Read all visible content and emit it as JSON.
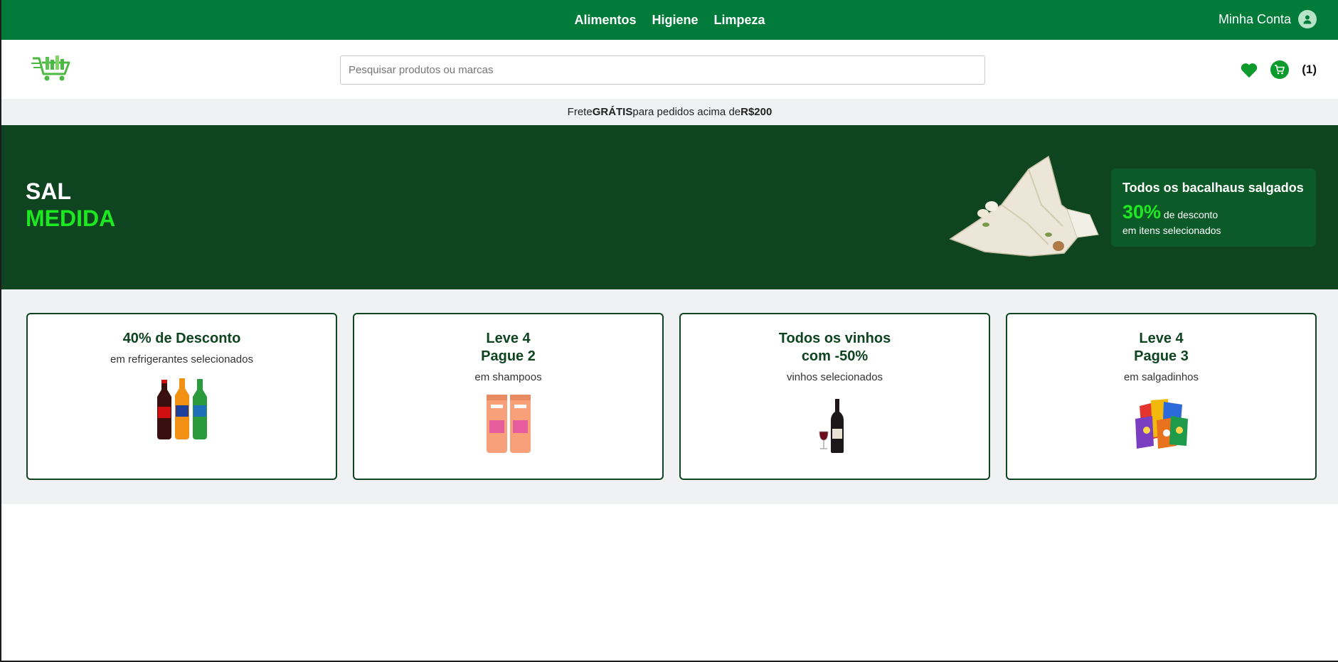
{
  "topnav": {
    "menu": [
      "Alimentos",
      "Higiene",
      "Limpeza"
    ],
    "account_label": "Minha Conta",
    "account_icon": "user-icon"
  },
  "header": {
    "logo_icon": "shopping-cart-logo",
    "search_placeholder": "Pesquisar produtos ou marcas",
    "favorites_icon": "heart-icon",
    "cart_icon": "cart-icon",
    "cart_count": "(1)"
  },
  "shipping": {
    "prefix": "Frete ",
    "free": "GRÁTIS",
    "middle": " para pedidos acima de ",
    "amount": "R$200"
  },
  "banner": {
    "brand_line1": "SAL",
    "brand_line2": "MEDIDA",
    "promo_title": "Todos os bacalhaus salgados",
    "promo_percent": "30%",
    "promo_percent_suffix": " de desconto",
    "promo_sub": "em itens selecionados"
  },
  "cards": [
    {
      "title_line1": "40% de Desconto",
      "title_line2": "",
      "subtitle": "em refrigerantes selecionados",
      "image": "soda-bottles"
    },
    {
      "title_line1": "Leve 4",
      "title_line2": "Pague 2",
      "subtitle": "em shampoos",
      "image": "shampoo-bottles"
    },
    {
      "title_line1": "Todos os vinhos",
      "title_line2": "com -50%",
      "subtitle": "vinhos selecionados",
      "image": "wine-bottle"
    },
    {
      "title_line1": "Leve 4",
      "title_line2": "Pague 3",
      "subtitle": "em salgadinhos",
      "image": "snack-bags"
    }
  ],
  "colors": {
    "primary_green": "#007b3a",
    "dark_green": "#0e4420",
    "accent_green": "#1ee821"
  }
}
